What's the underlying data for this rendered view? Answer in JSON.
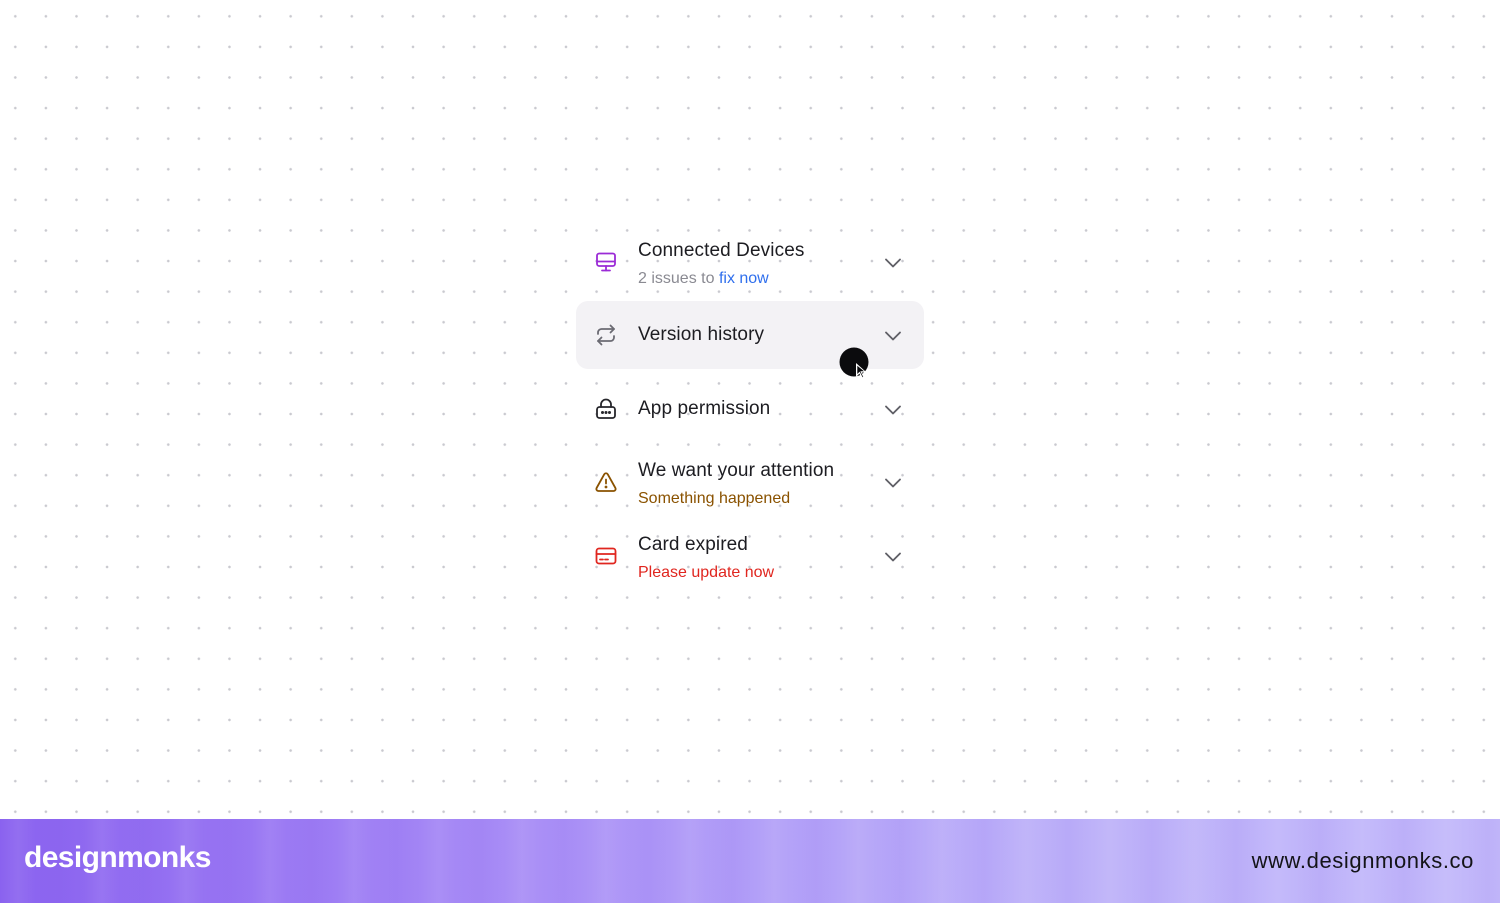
{
  "items": [
    {
      "icon": "monitor-icon",
      "icon_color": "#9b2bd6",
      "title": "Connected Devices",
      "subtitle_prefix": "2 issues to",
      "subtitle_link": "fix now",
      "subtitle_color": "#8a8a92",
      "link_color": "#2f6fed"
    },
    {
      "icon": "repeat-arrows-icon",
      "icon_color": "#6b6b73",
      "title": "Version history",
      "highlighted": true
    },
    {
      "icon": "lock-icon",
      "icon_color": "#26262b",
      "title": "App permission"
    },
    {
      "icon": "warning-triangle-icon",
      "icon_color": "#8a5200",
      "title": "We want your attention",
      "subtitle": "Something happened",
      "subtitle_color": "#8a5200"
    },
    {
      "icon": "credit-card-icon",
      "icon_color": "#e0261f",
      "title": "Card expired",
      "subtitle": "Please update now",
      "subtitle_color": "#e0261f"
    }
  ],
  "footer": {
    "brand": "designmonks",
    "url": "www.designmonks.co"
  },
  "colors": {
    "chevron": "#5f5f66",
    "hover_bg": "#f3f2f5",
    "cursor": "#0b0b0d"
  }
}
